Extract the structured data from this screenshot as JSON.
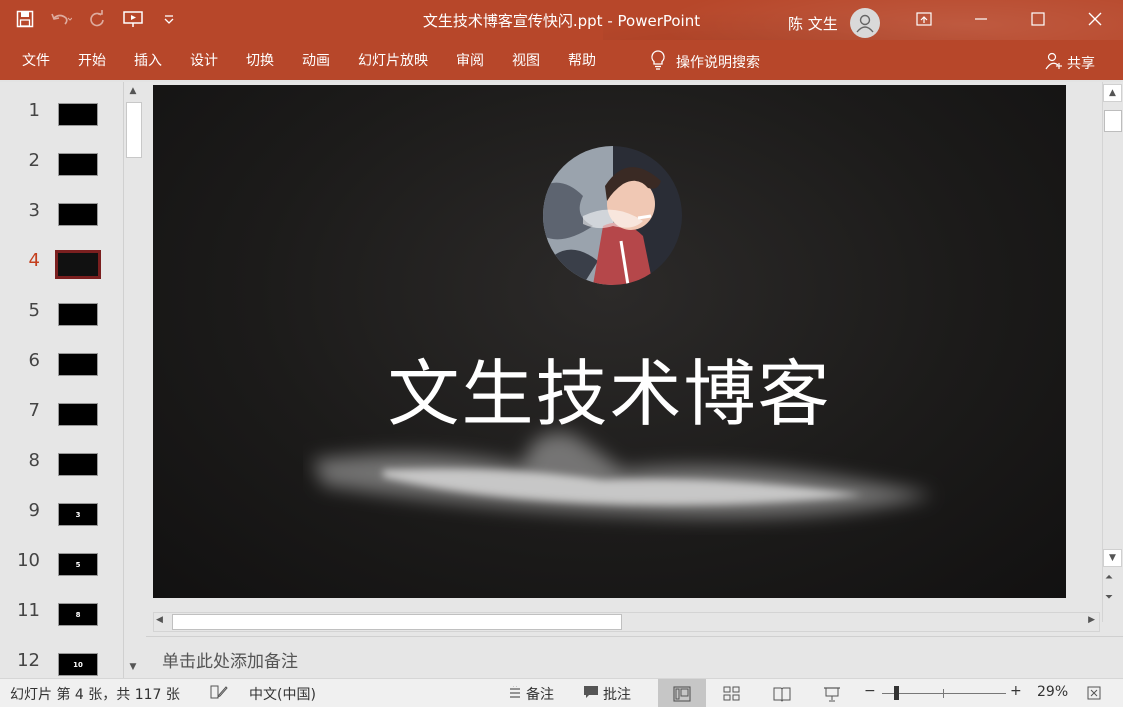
{
  "window": {
    "title": "文生技术博客宣传快闪.ppt  -  PowerPoint",
    "user_name": "陈 文生"
  },
  "ribbon": {
    "tabs": [
      "文件",
      "开始",
      "插入",
      "设计",
      "切换",
      "动画",
      "幻灯片放映",
      "审阅",
      "视图",
      "帮助"
    ],
    "tell_me": "操作说明搜索",
    "share": "共享"
  },
  "thumbnails": [
    {
      "num": "1",
      "label": "",
      "active": false
    },
    {
      "num": "2",
      "label": "",
      "active": false
    },
    {
      "num": "3",
      "label": "",
      "active": false
    },
    {
      "num": "4",
      "label": "",
      "active": true
    },
    {
      "num": "5",
      "label": "",
      "active": false
    },
    {
      "num": "6",
      "label": "",
      "active": false
    },
    {
      "num": "7",
      "label": "",
      "active": false
    },
    {
      "num": "8",
      "label": "",
      "active": false
    },
    {
      "num": "9",
      "label": "3",
      "active": false
    },
    {
      "num": "10",
      "label": "5",
      "active": false
    },
    {
      "num": "11",
      "label": "8",
      "active": false
    },
    {
      "num": "12",
      "label": "10",
      "active": false
    }
  ],
  "slide": {
    "title": "文生技术博客"
  },
  "notes": {
    "placeholder": "单击此处添加备注"
  },
  "status": {
    "slide_info": "幻灯片 第 4 张，共 117 张",
    "language": "中文(中国)",
    "notes_label": "备注",
    "comments_label": "批注",
    "zoom": "29%"
  },
  "colors": {
    "accent": "#b7472a",
    "active_slide_number": "#c43e1c"
  }
}
